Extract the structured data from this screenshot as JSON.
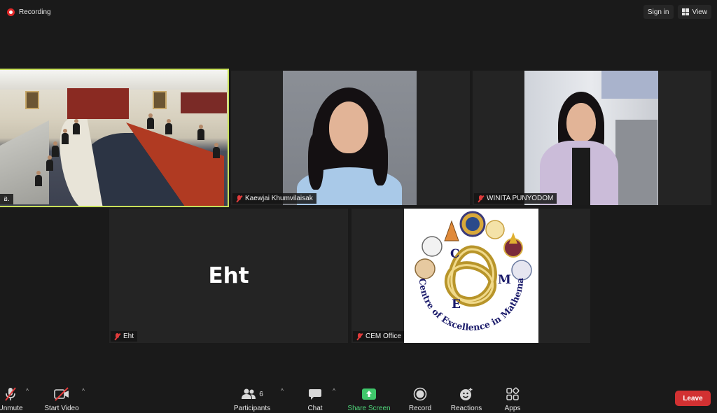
{
  "recording": {
    "label": "Recording"
  },
  "top_right": {
    "sign_in": "Sign in",
    "view": "View"
  },
  "tiles": {
    "room": {
      "name": "อ."
    },
    "kaewjai": {
      "name": "Kaewjai Khumvilaisak"
    },
    "winita": {
      "name": "WINITA PUNYODOM"
    },
    "eht": {
      "display": "Eht",
      "name": "Eht"
    },
    "cem": {
      "name": "CEM Office"
    }
  },
  "logo": {
    "letters": [
      "C",
      "M",
      "E"
    ],
    "arc_text": "Centre of Excellence in Mathematics"
  },
  "toolbar": {
    "unmute": "Unmute",
    "start_video": "Start Video",
    "participants": "Participants",
    "participants_count": "6",
    "chat": "Chat",
    "share_screen": "Share Screen",
    "record": "Record",
    "reactions": "Reactions",
    "apps": "Apps",
    "leave": "Leave"
  },
  "colors": {
    "active_speaker_border": "#c8e05a",
    "share_green": "#4fd67a",
    "leave_red": "#d23132",
    "muted_red": "#e03b3b"
  }
}
